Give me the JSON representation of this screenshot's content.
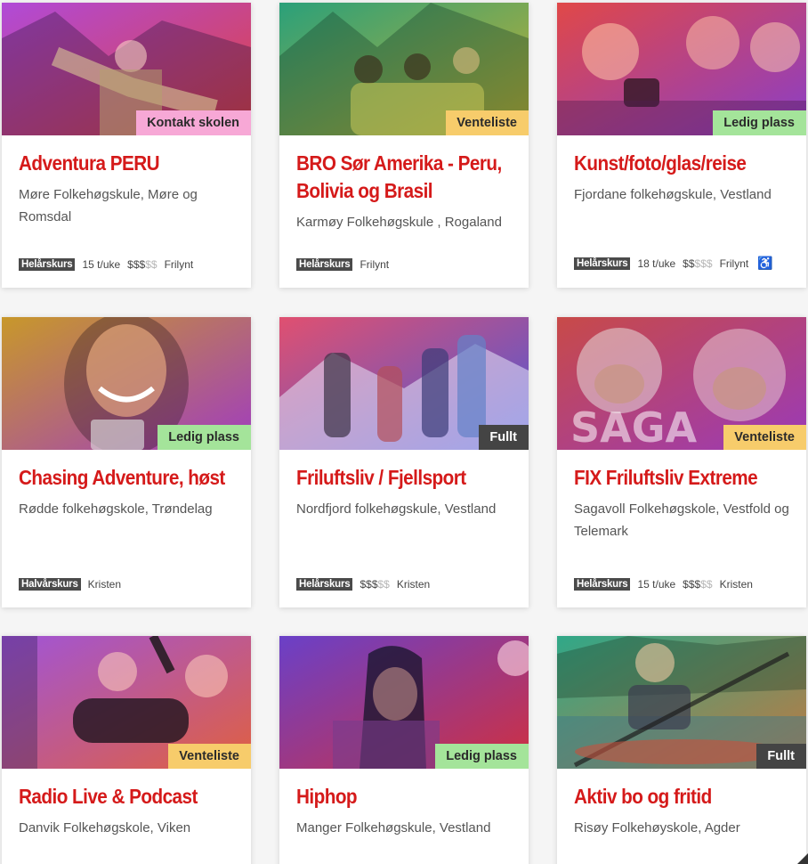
{
  "cards": [
    {
      "title": "Adventura PERU",
      "school": "Møre Folkehøgskule, Møre og Romsdal",
      "status": "Kontakt skolen",
      "status_color": "pink",
      "tag": "Helårskurs",
      "hours": "15 t/uke",
      "price_on": "$$$",
      "price_off": "$$",
      "profile": "Frilynt",
      "accessible": false,
      "gradient": [
        "#b04ad8",
        "#e0423e"
      ],
      "icon": "mountain-photo"
    },
    {
      "title": "BRO Sør Amerika - Peru, Bolivia og Brasil",
      "school": "Karmøy Folkehøgskule , Rogaland",
      "status": "Venteliste",
      "status_color": "yellow",
      "tag": "Helårskurs",
      "hours": "",
      "price_on": "",
      "price_off": "",
      "profile": "Frilynt",
      "accessible": false,
      "gradient": [
        "#2aa07a",
        "#c8b030"
      ],
      "icon": "group-photo"
    },
    {
      "title": "Kunst/foto/glas/reise",
      "school": "Fjordane folkehøgskule, Vestland",
      "status": "Ledig plass",
      "status_color": "green",
      "tag": "Helårskurs",
      "hours": "18 t/uke",
      "price_on": "$$",
      "price_off": "$$$",
      "profile": "Frilynt",
      "accessible": true,
      "gradient": [
        "#e04848",
        "#8a3ec8"
      ],
      "icon": "camera-photo"
    },
    {
      "title": "Chasing Adventure, høst",
      "school": "Rødde folkehøgskole, Trøndelag",
      "status": "Ledig plass",
      "status_color": "green",
      "tag": "Halvårskurs",
      "hours": "",
      "price_on": "",
      "price_off": "",
      "profile": "Kristen",
      "accessible": false,
      "gradient": [
        "#c8982a",
        "#a03cc0"
      ],
      "icon": "portrait-photo"
    },
    {
      "title": "Friluftsliv / Fjellsport",
      "school": "Nordfjord folkehøgskule, Vestland",
      "status": "Fullt",
      "status_color": "dark",
      "tag": "Helårskurs",
      "hours": "",
      "price_on": "$$$",
      "price_off": "$$",
      "profile": "Kristen",
      "accessible": false,
      "gradient": [
        "#e05070",
        "#4a58d8"
      ],
      "icon": "hikers-photo"
    },
    {
      "title": "FIX Friluftsliv Extreme",
      "school": "Sagavoll Folkehøgskole, Vestfold og Telemark",
      "status": "Venteliste",
      "status_color": "yellow",
      "tag": "Helårskurs",
      "hours": "15 t/uke",
      "price_on": "$$$",
      "price_off": "$$",
      "profile": "Kristen",
      "accessible": false,
      "gradient": [
        "#c84a48",
        "#9a3ab8"
      ],
      "icon": "helmets-photo",
      "watermark": "SAGA"
    },
    {
      "title": "Radio Live & Podcast",
      "school": "Danvik Folkehøgskole, Viken",
      "status": "Venteliste",
      "status_color": "yellow",
      "tag": "",
      "hours": "",
      "price_on": "",
      "price_off": "",
      "profile": "",
      "accessible": false,
      "gradient": [
        "#a054d8",
        "#e06040"
      ],
      "icon": "studio-photo"
    },
    {
      "title": "Hiphop",
      "school": "Manger Folkehøgskule, Vestland",
      "status": "Ledig plass",
      "status_color": "green",
      "tag": "",
      "hours": "",
      "price_on": "",
      "price_off": "",
      "profile": "",
      "accessible": false,
      "gradient": [
        "#6a40c8",
        "#d03040"
      ],
      "icon": "singer-photo"
    },
    {
      "title": "Aktiv bo og fritid",
      "school": "Risøy Folkehøyskole, Agder",
      "status": "Fullt",
      "status_color": "dark",
      "tag": "",
      "hours": "",
      "price_on": "",
      "price_off": "",
      "profile": "",
      "accessible": false,
      "gradient": [
        "#30a888",
        "#c07840"
      ],
      "icon": "kayak-photo"
    }
  ]
}
